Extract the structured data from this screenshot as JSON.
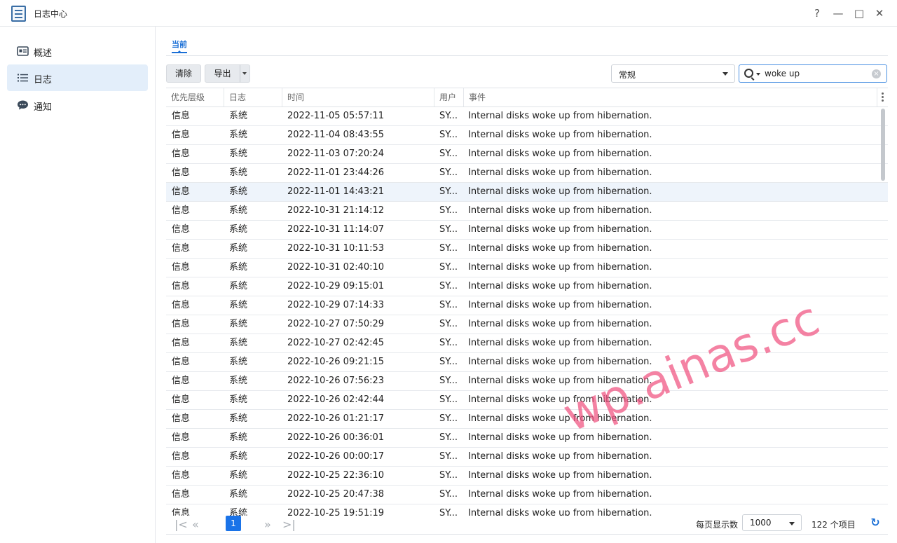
{
  "window": {
    "title": "日志中心",
    "help_label": "?",
    "minimize_label": "—",
    "maximize_label": "□",
    "close_label": "✕"
  },
  "sidebar": {
    "items": [
      {
        "label": "概述",
        "icon": "overview-icon"
      },
      {
        "label": "日志",
        "icon": "list-icon",
        "active": true
      },
      {
        "label": "通知",
        "icon": "chat-icon"
      }
    ]
  },
  "tabs": [
    {
      "label": "当前",
      "active": true
    }
  ],
  "toolbar": {
    "clear_label": "清除",
    "export_label": "导出",
    "level_filter": "常规",
    "search_value": "woke up"
  },
  "table": {
    "columns": [
      "优先层级",
      "日志",
      "时间",
      "用户",
      "事件"
    ],
    "rows": [
      [
        "信息",
        "系统",
        "2022-11-05 05:57:11",
        "SY...",
        "Internal disks woke up from hibernation."
      ],
      [
        "信息",
        "系统",
        "2022-11-04 08:43:55",
        "SY...",
        "Internal disks woke up from hibernation."
      ],
      [
        "信息",
        "系统",
        "2022-11-03 07:20:24",
        "SY...",
        "Internal disks woke up from hibernation."
      ],
      [
        "信息",
        "系统",
        "2022-11-01 23:44:26",
        "SY...",
        "Internal disks woke up from hibernation."
      ],
      [
        "信息",
        "系统",
        "2022-11-01 14:43:21",
        "SY...",
        "Internal disks woke up from hibernation."
      ],
      [
        "信息",
        "系统",
        "2022-10-31 21:14:12",
        "SY...",
        "Internal disks woke up from hibernation."
      ],
      [
        "信息",
        "系统",
        "2022-10-31 11:14:07",
        "SY...",
        "Internal disks woke up from hibernation."
      ],
      [
        "信息",
        "系统",
        "2022-10-31 10:11:53",
        "SY...",
        "Internal disks woke up from hibernation."
      ],
      [
        "信息",
        "系统",
        "2022-10-31 02:40:10",
        "SY...",
        "Internal disks woke up from hibernation."
      ],
      [
        "信息",
        "系统",
        "2022-10-29 09:15:01",
        "SY...",
        "Internal disks woke up from hibernation."
      ],
      [
        "信息",
        "系统",
        "2022-10-29 07:14:33",
        "SY...",
        "Internal disks woke up from hibernation."
      ],
      [
        "信息",
        "系统",
        "2022-10-27 07:50:29",
        "SY...",
        "Internal disks woke up from hibernation."
      ],
      [
        "信息",
        "系统",
        "2022-10-27 02:42:45",
        "SY...",
        "Internal disks woke up from hibernation."
      ],
      [
        "信息",
        "系统",
        "2022-10-26 09:21:15",
        "SY...",
        "Internal disks woke up from hibernation."
      ],
      [
        "信息",
        "系统",
        "2022-10-26 07:56:23",
        "SY...",
        "Internal disks woke up from hibernation."
      ],
      [
        "信息",
        "系统",
        "2022-10-26 02:42:44",
        "SY...",
        "Internal disks woke up from hibernation."
      ],
      [
        "信息",
        "系统",
        "2022-10-26 01:21:17",
        "SY...",
        "Internal disks woke up from hibernation."
      ],
      [
        "信息",
        "系统",
        "2022-10-26 00:36:01",
        "SY...",
        "Internal disks woke up from hibernation."
      ],
      [
        "信息",
        "系统",
        "2022-10-26 00:00:17",
        "SY...",
        "Internal disks woke up from hibernation."
      ],
      [
        "信息",
        "系统",
        "2022-10-25 22:36:10",
        "SY...",
        "Internal disks woke up from hibernation."
      ],
      [
        "信息",
        "系统",
        "2022-10-25 20:47:38",
        "SY...",
        "Internal disks woke up from hibernation."
      ],
      [
        "信息",
        "系统",
        "2022-10-25 19:51:19",
        "SY...",
        "Internal disks woke up from hibernation."
      ]
    ],
    "highlighted_row": 4
  },
  "pagination": {
    "current_page": "1",
    "per_page_label": "每页显示数",
    "per_page_value": "1000",
    "total_label": "122 个项目"
  },
  "watermark": "wp.ainas.cc",
  "colors": {
    "accent": "#1a6fd6",
    "selected_nav": "#e3eefa",
    "watermark": "#f05280"
  }
}
